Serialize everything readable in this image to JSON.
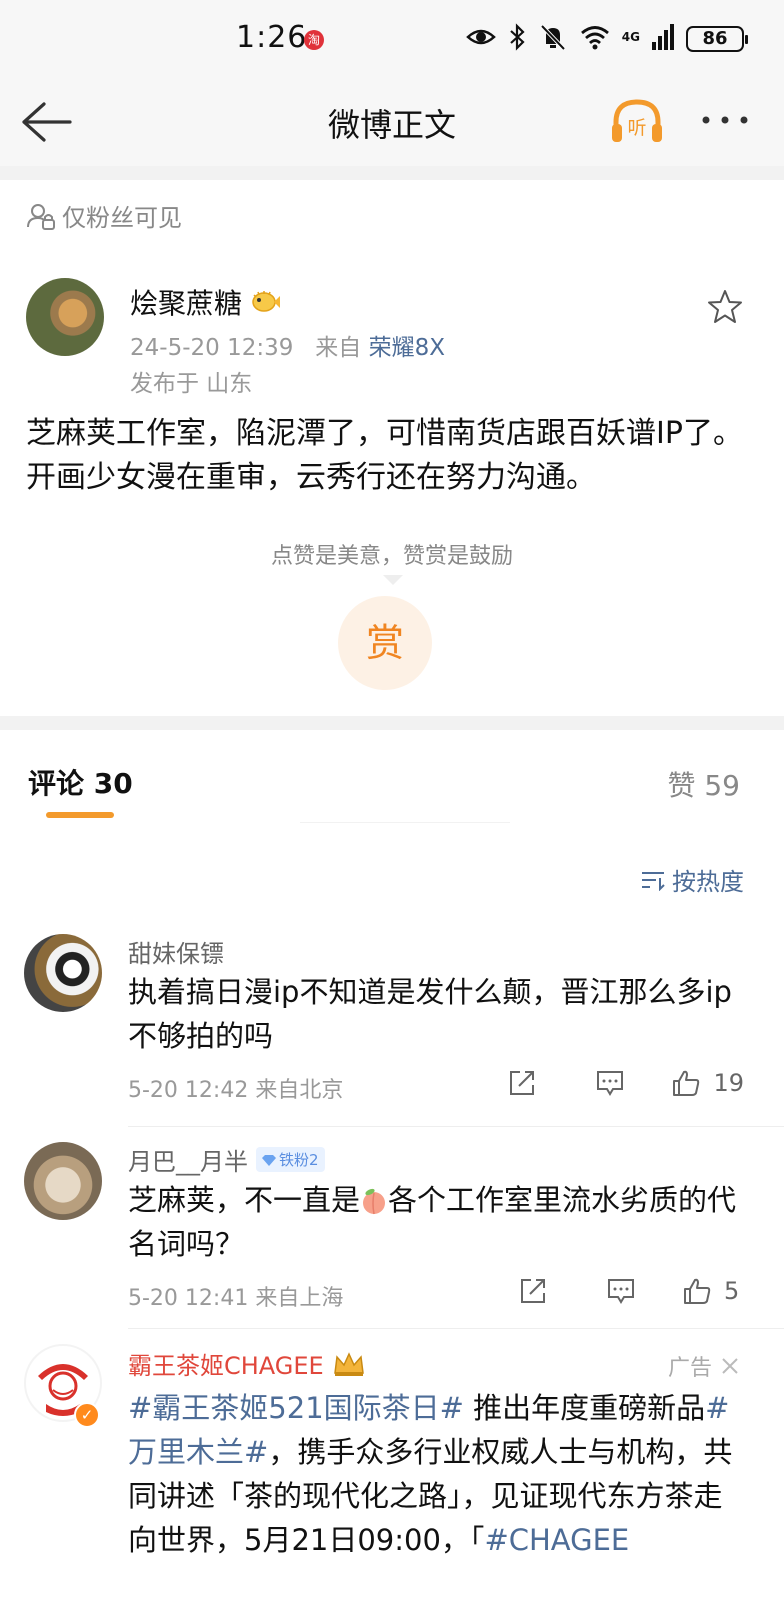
{
  "status_bar": {
    "time": "1:26",
    "network": "4G",
    "battery": "86"
  },
  "nav": {
    "title": "微博正文",
    "listen_label": "听"
  },
  "visibility": "仅粉丝可见",
  "post": {
    "author": "烩聚蔗糖",
    "date": "24-5-20 12:39",
    "from_label": "来自",
    "device": "荣耀8X",
    "location": "发布于 山东",
    "text": "芝麻荚工作室，陷泥潭了，可惜南货店跟百妖谱IP了。开画少女漫在重审，云秀行还在努力沟通。",
    "reward_tip": "点赞是美意，赞赏是鼓励",
    "reward_button": "赏"
  },
  "tabs": {
    "comments": "评论 30",
    "likes": "赞 59"
  },
  "sort_label": "按热度",
  "comments": [
    {
      "name": "甜妹保镖",
      "text": "执着搞日漫ip不知道是发什么颠，晋江那么多ip不够拍的吗",
      "meta": "5-20 12:42 来自北京",
      "likes": "19"
    },
    {
      "name": "月巴__月半",
      "badge": "铁粉2",
      "text_before": "芝麻荚，不一直是",
      "text_after": "各个工作室里流水劣质的代名词吗？",
      "meta": "5-20 12:41 来自上海",
      "likes": "5"
    }
  ],
  "ad": {
    "name": "霸王茶姬CHAGEE",
    "label": "广告",
    "topic1": "#霸王茶姬521国际茶日#",
    "text1": " 推出年度重磅新品",
    "topic2": "#万里木兰#",
    "text2": "，携手众多行业权威人士与机构，共同讲述「茶的现代化之路」，见证现代东方茶走向世界，5月21日09:00，「",
    "topic3": "#CHAGEE"
  },
  "colors": {
    "accent": "#f39a2c",
    "link": "#4d6c97",
    "ad_red": "#e0473b"
  }
}
